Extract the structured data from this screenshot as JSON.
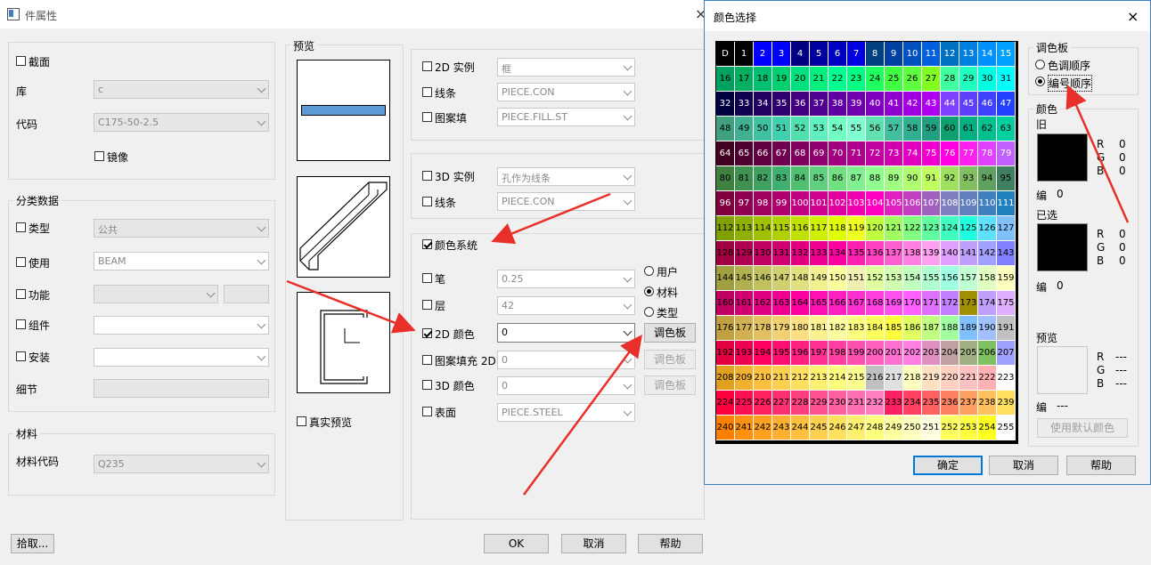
{
  "main_window": {
    "title": "件属性",
    "close_glyph": "×",
    "section": {
      "checkbox_label": "截面",
      "checked": false
    },
    "library": {
      "label": "库",
      "value": "c"
    },
    "code": {
      "label": "代码",
      "value": "C175-50-2.5"
    },
    "mirror": {
      "label": "镜像",
      "checked": false
    },
    "classification": {
      "title": "分类数据",
      "type": {
        "label": "类型",
        "value": "公共"
      },
      "use": {
        "label": "使用",
        "value": "BEAM"
      },
      "function": {
        "label": "功能",
        "value": ""
      },
      "assembly": {
        "label": "组件",
        "value": ""
      },
      "install": {
        "label": "安装",
        "value": ""
      },
      "detail": {
        "label": "细节",
        "value": ""
      }
    },
    "material": {
      "title": "材料",
      "code_label": "材料代码",
      "code_value": "Q235"
    },
    "preview": {
      "title": "预览",
      "real_preview_label": "真实预览"
    },
    "right_2d": {
      "instance_label": "2D 实例",
      "instance_value": "框",
      "line_label": "线条",
      "line_value": "PIECE.CON",
      "pattern_label": "图案填",
      "pattern_value": "PIECE.FILL.ST"
    },
    "right_3d": {
      "instance_label": "3D 实例",
      "instance_value": "孔作为线条",
      "line_label": "线条",
      "line_value": "PIECE.CON"
    },
    "color_system": {
      "label": "颜色系统",
      "pen_label": "笔",
      "pen_value": "0.25",
      "layer_label": "层",
      "layer_value": "42",
      "color2d_label": "2D 颜色",
      "color2d_value": "0",
      "fill2d_label": "图案填充 2D",
      "fill2d_value": "0",
      "color3d_label": "3D 颜色",
      "color3d_value": "0",
      "surface_label": "表面",
      "surface_value": "PIECE.STEEL",
      "radio_user": "用户",
      "radio_material": "材料",
      "radio_type": "类型",
      "palette_btn": "调色板"
    },
    "buttons": {
      "pick": "拾取...",
      "ok": "OK",
      "cancel": "取消",
      "help": "帮助"
    }
  },
  "color_dialog": {
    "title": "颜色选择",
    "close_glyph": "×",
    "palette_group": "调色板",
    "radio_hue": "色调顺序",
    "radio_number": "编号顺序",
    "color_group": "颜色",
    "old_label": "旧",
    "selected_label": "已选",
    "preview_label": "预览",
    "r_label": "R",
    "g_label": "G",
    "b_label": "B",
    "num_label": "编",
    "old": {
      "r": "0",
      "g": "0",
      "b": "0",
      "num": "0"
    },
    "selected": {
      "r": "0",
      "g": "0",
      "b": "0",
      "num": "0"
    },
    "preview": {
      "r": "---",
      "g": "---",
      "b": "---",
      "num": "---"
    },
    "default_btn": "使用默认颜色",
    "ok": "确定",
    "cancel": "取消",
    "help": "帮助",
    "cells": [
      "D",
      "1",
      "2",
      "3",
      "4",
      "5",
      "6",
      "7",
      "8",
      "9",
      "10",
      "11",
      "12",
      "13",
      "14",
      "15",
      "16",
      "17",
      "18",
      "19",
      "20",
      "21",
      "22",
      "23",
      "24",
      "25",
      "26",
      "27",
      "28",
      "29",
      "30",
      "31",
      "32",
      "33",
      "34",
      "35",
      "36",
      "37",
      "38",
      "39",
      "40",
      "41",
      "42",
      "43",
      "44",
      "45",
      "46",
      "47",
      "48",
      "49",
      "50",
      "51",
      "52",
      "53",
      "54",
      "55",
      "56",
      "57",
      "58",
      "59",
      "60",
      "61",
      "62",
      "63",
      "64",
      "65",
      "66",
      "67",
      "68",
      "69",
      "70",
      "71",
      "72",
      "73",
      "74",
      "75",
      "76",
      "77",
      "78",
      "79",
      "80",
      "81",
      "82",
      "83",
      "84",
      "85",
      "86",
      "87",
      "88",
      "89",
      "90",
      "91",
      "92",
      "93",
      "94",
      "95",
      "96",
      "97",
      "98",
      "99",
      "100",
      "101",
      "102",
      "103",
      "104",
      "105",
      "106",
      "107",
      "108",
      "109",
      "110",
      "111",
      "112",
      "113",
      "114",
      "115",
      "116",
      "117",
      "118",
      "119",
      "120",
      "121",
      "122",
      "123",
      "124",
      "125",
      "126",
      "127",
      "128",
      "129",
      "130",
      "131",
      "132",
      "133",
      "134",
      "135",
      "136",
      "137",
      "138",
      "139",
      "140",
      "141",
      "142",
      "143",
      "144",
      "145",
      "146",
      "147",
      "148",
      "149",
      "150",
      "151",
      "152",
      "153",
      "154",
      "155",
      "156",
      "157",
      "158",
      "159",
      "160",
      "161",
      "162",
      "163",
      "164",
      "165",
      "166",
      "167",
      "168",
      "169",
      "170",
      "171",
      "172",
      "173",
      "174",
      "175",
      "176",
      "177",
      "178",
      "179",
      "180",
      "181",
      "182",
      "183",
      "184",
      "185",
      "186",
      "187",
      "188",
      "189",
      "190",
      "191",
      "192",
      "193",
      "194",
      "195",
      "196",
      "197",
      "198",
      "199",
      "200",
      "201",
      "202",
      "203",
      "204",
      "205",
      "206",
      "207",
      "208",
      "209",
      "210",
      "211",
      "212",
      "213",
      "214",
      "215",
      "216",
      "217",
      "218",
      "219",
      "220",
      "221",
      "222",
      "223",
      "224",
      "225",
      "226",
      "227",
      "228",
      "229",
      "230",
      "231",
      "232",
      "233",
      "234",
      "235",
      "236",
      "237",
      "238",
      "239",
      "240",
      "241",
      "242",
      "243",
      "244",
      "245",
      "246",
      "247",
      "248",
      "249",
      "250",
      "251",
      "252",
      "253",
      "254",
      "255"
    ],
    "row_colors": [
      [
        "#000000",
        "#000000",
        "#0000ff",
        "#0000ff",
        "#000080",
        "#0000a0",
        "#0000c0",
        "#0000e0",
        "#004080",
        "#0040a0",
        "#0050c0",
        "#0060e0",
        "#0070c0",
        "#0080e0",
        "#0090ff",
        "#00a0ff"
      ],
      [
        "#00a060",
        "#00b060",
        "#00c070",
        "#00d070",
        "#00e080",
        "#00f080",
        "#00ff90",
        "#00ff80",
        "#20ff60",
        "#40ff40",
        "#60ff40",
        "#80ff20",
        "#40ffa0",
        "#20ffc0",
        "#00ffe0",
        "#00ffff"
      ],
      [
        "#000040",
        "#100050",
        "#200060",
        "#300070",
        "#400080",
        "#500090",
        "#6000a0",
        "#7000b0",
        "#8000c0",
        "#9000d0",
        "#a000e0",
        "#b000f0",
        "#8040ff",
        "#6040ff",
        "#4040ff",
        "#2040ff"
      ],
      [
        "#40a080",
        "#40b090",
        "#40c0a0",
        "#40d0b0",
        "#50e0b0",
        "#60f0c0",
        "#70ffc0",
        "#80ffd0",
        "#60e0b0",
        "#40c0a0",
        "#30b090",
        "#20a080",
        "#10a070",
        "#00b080",
        "#00c090",
        "#00d0a0"
      ],
      [
        "#400020",
        "#500030",
        "#600040",
        "#700050",
        "#800060",
        "#900070",
        "#a00080",
        "#b00090",
        "#c000a0",
        "#d000b0",
        "#e000c0",
        "#f000d0",
        "#ff00e0",
        "#ff20f0",
        "#e040ff",
        "#c060ff"
      ],
      [
        "#408040",
        "#409050",
        "#40a060",
        "#40b070",
        "#50c070",
        "#60d080",
        "#70e080",
        "#80f090",
        "#90ff90",
        "#a0ff80",
        "#b0ff70",
        "#c0ff60",
        "#a0e060",
        "#80c060",
        "#60a060",
        "#408060"
      ],
      [
        "#800040",
        "#900050",
        "#a00060",
        "#b00070",
        "#c00080",
        "#d00090",
        "#e000a0",
        "#f000b0",
        "#ff00c0",
        "#e020c0",
        "#c040c0",
        "#a060c0",
        "#8080c0",
        "#6080c0",
        "#4080c0",
        "#2080c0"
      ],
      [
        "#80a000",
        "#90b000",
        "#a0c000",
        "#b0d000",
        "#c0e000",
        "#d0f000",
        "#e0ff00",
        "#f0ff20",
        "#c0ff40",
        "#a0ff60",
        "#80ff80",
        "#60ffa0",
        "#40ffc0",
        "#20ffe0",
        "#60e0ff",
        "#80c0ff"
      ],
      [
        "#a00040",
        "#b00050",
        "#c00060",
        "#d00070",
        "#e00080",
        "#f00090",
        "#ff00a0",
        "#ff20b0",
        "#ff40c0",
        "#ff60d0",
        "#ff80e0",
        "#ffa0f0",
        "#e0a0ff",
        "#c0a0ff",
        "#a0a0ff",
        "#8080ff"
      ],
      [
        "#a0a040",
        "#b0b050",
        "#c0c060",
        "#d0d070",
        "#e0e080",
        "#f0f090",
        "#ffffa0",
        "#f0f0b0",
        "#e0ffa0",
        "#d0ffb0",
        "#c0ffc0",
        "#b0ffd0",
        "#a0ffe0",
        "#c0ffd0",
        "#e0ffc0",
        "#ffffc0"
      ],
      [
        "#c00060",
        "#d00070",
        "#e00080",
        "#f00090",
        "#ff00a0",
        "#ff10b0",
        "#ff20c0",
        "#ff30d0",
        "#ff40e0",
        "#ff50f0",
        "#ff60ff",
        "#e070ff",
        "#c080ff",
        "#a09000",
        "#c0a0ff",
        "#e0b0ff"
      ],
      [
        "#c0a040",
        "#d0b050",
        "#e0c060",
        "#f0d070",
        "#ffe080",
        "#fff090",
        "#ffffa0",
        "#ffff80",
        "#ffff60",
        "#ffff40",
        "#e0ff60",
        "#c0ff80",
        "#a0ffa0",
        "#80c0ff",
        "#a0c0ff",
        "#c0c0c0"
      ],
      [
        "#e00040",
        "#f00050",
        "#ff0060",
        "#ff1070",
        "#ff2080",
        "#ff3090",
        "#ff40a0",
        "#ff50b0",
        "#ff60c0",
        "#ff70d0",
        "#ff80e0",
        "#e090c0",
        "#c0a0a0",
        "#a0b080",
        "#80c060",
        "#a0a0ff"
      ],
      [
        "#e0a020",
        "#f0b030",
        "#ffc040",
        "#ffd050",
        "#ffe060",
        "#fff070",
        "#ffff80",
        "#ffff90",
        "#c0c0c0",
        "#e0e0e0",
        "#ffffc0",
        "#ffe0c0",
        "#ffd0c0",
        "#ffc0c0",
        "#ffb0b0",
        "#ffffff"
      ],
      [
        "#ff0040",
        "#ff1050",
        "#ff2060",
        "#ff3070",
        "#ff4080",
        "#ff5090",
        "#ff60a0",
        "#ff70b0",
        "#ff80c0",
        "#ff2060",
        "#ff4060",
        "#ff6060",
        "#ff8060",
        "#ffa060",
        "#ffc060",
        "#ffe060"
      ],
      [
        "#ff8000",
        "#ff9010",
        "#ffa020",
        "#ffb030",
        "#ffc040",
        "#ffd050",
        "#ffe060",
        "#fff070",
        "#ffff80",
        "#ffffa0",
        "#ffffc0",
        "#ffffe0",
        "#ffff60",
        "#ffff40",
        "#ffff20",
        "#ffffff"
      ]
    ],
    "light_text_rows": [
      0,
      2,
      4,
      6
    ]
  }
}
